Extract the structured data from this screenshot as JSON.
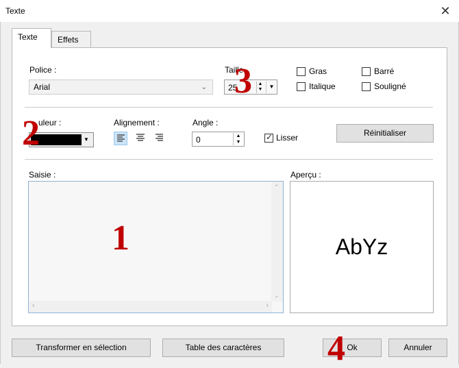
{
  "window": {
    "title": "Texte",
    "close_glyph": "✕"
  },
  "tabs": [
    {
      "label": "Texte",
      "active": true
    },
    {
      "label": "Effets",
      "active": false
    }
  ],
  "font": {
    "police_label": "Police :",
    "police_value": "Arial",
    "taille_label": "Taille",
    "taille_value": "25",
    "styles": [
      {
        "label": "Gras",
        "checked": false
      },
      {
        "label": "Barré",
        "checked": false
      },
      {
        "label": "Italique",
        "checked": false
      },
      {
        "label": "Souligné",
        "checked": false
      }
    ]
  },
  "color": {
    "couleur_label": "uleur :",
    "swatch": "#000000"
  },
  "alignment": {
    "label": "Alignement :",
    "options": [
      "left-align-icon",
      "center-align-icon",
      "right-align-icon"
    ],
    "selected": "left"
  },
  "angle": {
    "label": "Angle :",
    "value": "0"
  },
  "lisser": {
    "label": "Lisser",
    "checked": true
  },
  "reset_button": "Réinitialiser",
  "saisie": {
    "label": "Saisie :",
    "value": ""
  },
  "apercu": {
    "label": "Aperçu :",
    "sample": "AbYz"
  },
  "footer": {
    "transform_button": "Transformer en sélection",
    "table_button": "Table des caractères",
    "ok_button": "Ok",
    "cancel_button": "Annuler"
  },
  "markers": [
    "1",
    "2",
    "3",
    "4"
  ],
  "colors": {
    "marker": "#c00000",
    "accent": "#0078d7"
  }
}
